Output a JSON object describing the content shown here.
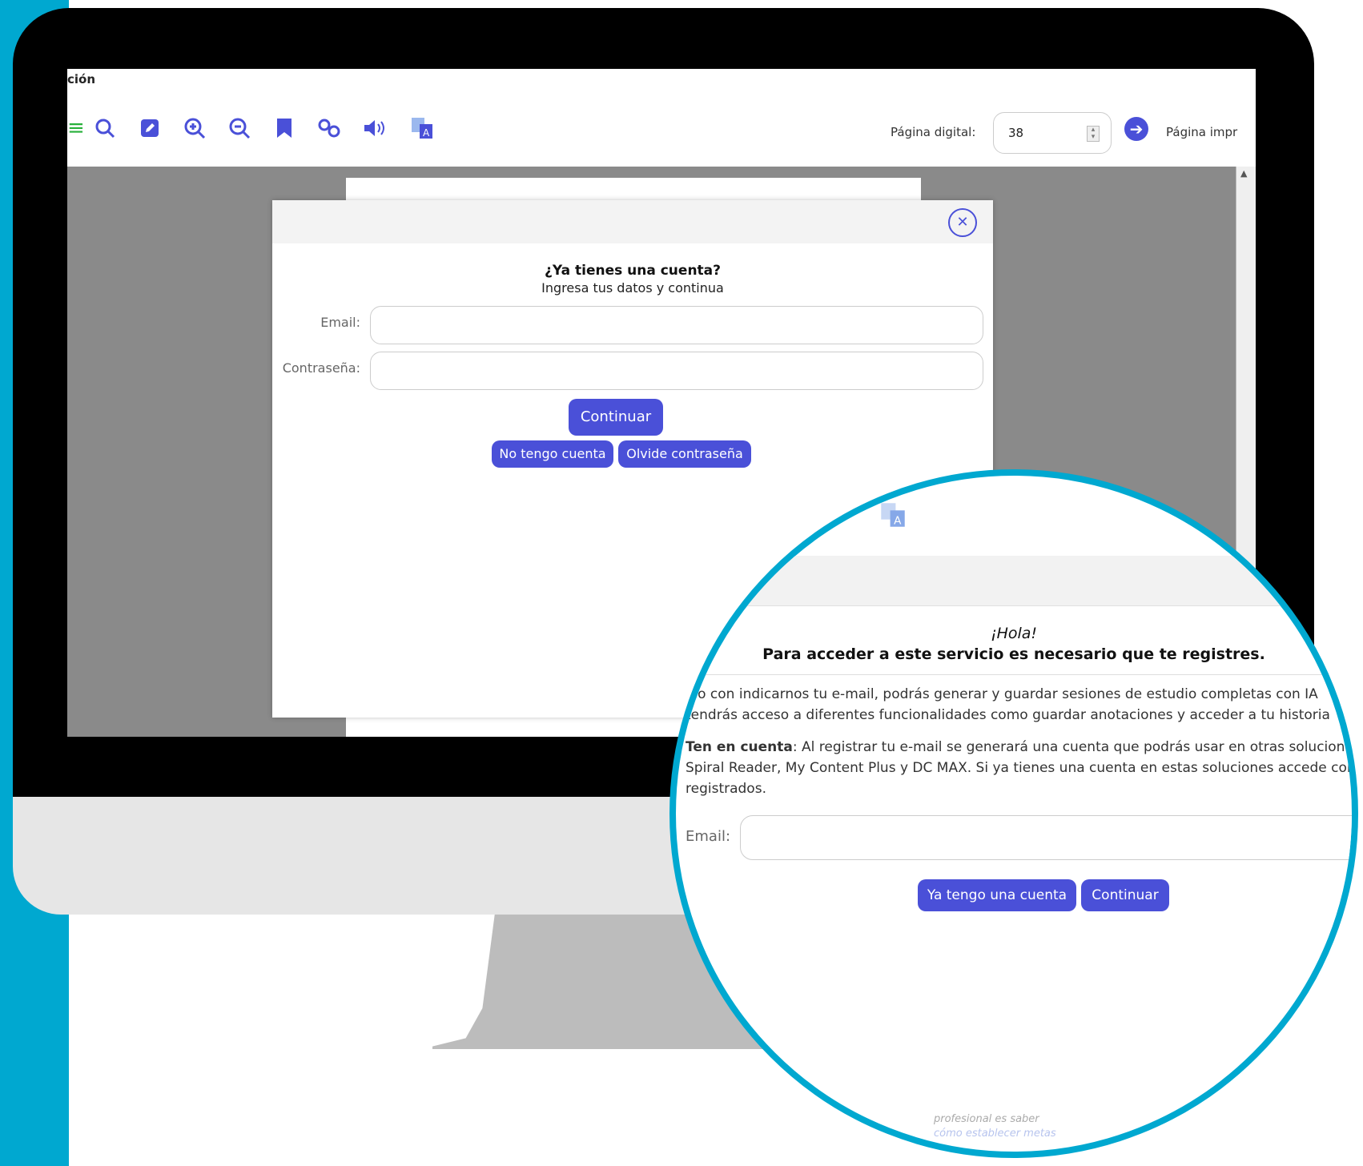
{
  "screen": {
    "title": "ción",
    "toolbar": {
      "page_label": "Página digital:",
      "page_value": "38",
      "page_label2": "Página impr"
    }
  },
  "login_modal": {
    "heading": "¿Ya tienes una cuenta?",
    "subheading": "Ingresa tus datos y continua",
    "email_label": "Email:",
    "password_label": "Contraseña:",
    "continue_label": "Continuar",
    "no_account_label": "No tengo cuenta",
    "forgot_label": "Olvide contraseña"
  },
  "register_modal": {
    "greeting": "¡Hola!",
    "subtitle": "Para acceder a este servicio es necesario que te registres.",
    "line1": "olo con indicarnos tu e-mail, podrás generar y guardar sesiones de estudio completas con IA",
    "line2": "tendrás acceso a diferentes funcionalidades como guardar anotaciones y acceder a tu historia",
    "note_bold": "Ten en cuenta",
    "note_line1": ": Al registrar tu e-mail se generará una cuenta que podrás usar en otras solucione",
    "note_line2": "Spiral Reader, My Content Plus y DC MAX. Si ya tienes una cuenta en estas soluciones accede con",
    "note_line3": "registrados.",
    "email_label": "Email:",
    "have_account_label": "Ya tengo una cuenta",
    "continue_label": "Continuar",
    "bottom_text1": "profesional es saber",
    "bottom_text2": "cómo establecer metas"
  },
  "colors": {
    "accent": "#4a50d8",
    "frame": "#00a8d0",
    "monitor": "#000000",
    "overlay": "#8a8a8a"
  }
}
